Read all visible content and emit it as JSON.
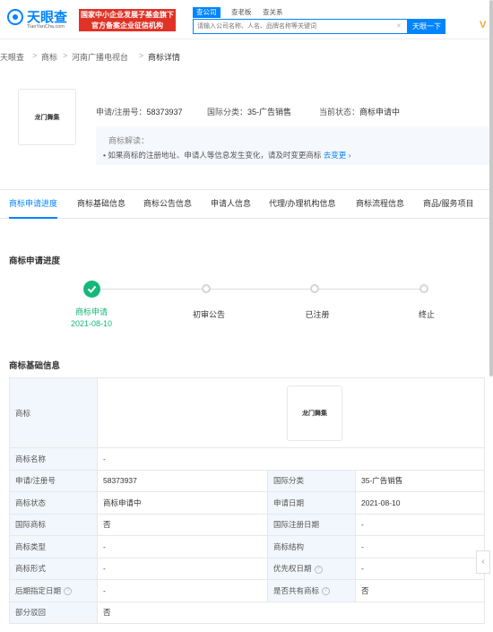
{
  "header": {
    "logo_name": "天眼查",
    "logo_sub": "TianYanCha.com",
    "gov_badge_line1": "国家中小企业发展子基金旗下",
    "gov_badge_line2": "官方备案企业征信机构",
    "nav_tabs": [
      "查公司",
      "查老板",
      "查关系"
    ],
    "search_placeholder": "请输入公司名称、人名、品牌名称等关键词",
    "search_button": "天眼一下",
    "partial_logo": "V"
  },
  "breadcrumb": [
    "天眼查",
    ">",
    "商标",
    ">",
    "河南广播电视台",
    ">",
    "商标详情"
  ],
  "summary": {
    "image_text": "龙门舞集",
    "reg_no_label": "申请/注册号：",
    "reg_no": "58373937",
    "class_label": "国际分类：",
    "class": "35-广告销售",
    "status_label": "当前状态：",
    "status": "商标申请中",
    "hint_title": "商标解读：",
    "hint_text": "• 如果商标的注册地址、申请人等信息发生变化，请及时变更商标",
    "hint_link": "去变更 ›"
  },
  "tabs": [
    "商标申请进度",
    "商标基础信息",
    "商标公告信息",
    "申请人信息",
    "代理/办理机构信息",
    "商标流程信息",
    "商品/服务项目"
  ],
  "progress": {
    "title": "商标申请进度",
    "steps": [
      "商标申请",
      "初审公告",
      "已注册",
      "终止"
    ],
    "first_date": "2021-08-10",
    "colors": {
      "done": "#16b87a",
      "pending": "#d5d5d5"
    }
  },
  "basic_info": {
    "title": "商标基础信息",
    "trademark_label": "商标",
    "trademark_image_text": "龙门舞集",
    "rows": [
      {
        "k1": "商标名称",
        "v1": "-",
        "k2": "",
        "v2": ""
      },
      {
        "k1": "申请/注册号",
        "v1": "58373937",
        "k2": "国际分类",
        "v2": "35-广告销售"
      },
      {
        "k1": "商标状态",
        "v1": "商标申请中",
        "k2": "申请日期",
        "v2": "2021-08-10"
      },
      {
        "k1": "国际商标",
        "v1": "否",
        "k2": "国际注册日期",
        "v2": "-"
      },
      {
        "k1": "商标类型",
        "v1": "-",
        "k2": "商标结构",
        "v2": "-"
      },
      {
        "k1": "商标形式",
        "v1": "-",
        "k2": "优先权日期",
        "v2": "-"
      },
      {
        "k1": "后期指定日期",
        "v1": "-",
        "k2": "是否共有商标",
        "v2": "否"
      },
      {
        "k1": "部分驳回",
        "v1": "否",
        "k2": "",
        "v2": ""
      }
    ],
    "help_glyph": "?"
  },
  "side_arrow": "‹",
  "accent_color": "#0084ff"
}
